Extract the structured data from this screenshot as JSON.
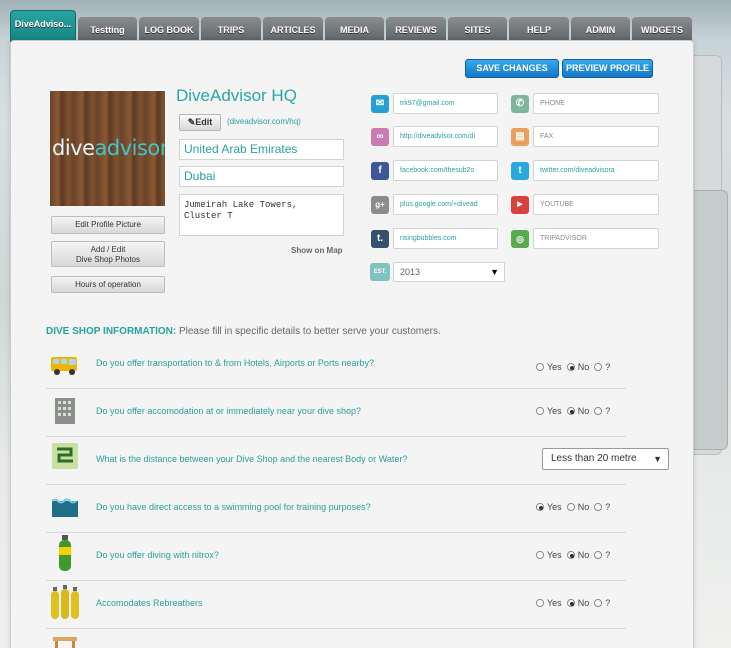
{
  "tabs": [
    {
      "label": "DiveAdvisor HQ",
      "active": true
    },
    {
      "label": "Testting"
    },
    {
      "label": "LOG BOOK"
    },
    {
      "label": "TRIPS"
    },
    {
      "label": "ARTICLES"
    },
    {
      "label": "MEDIA"
    },
    {
      "label": "REVIEWS"
    },
    {
      "label": "SITES"
    },
    {
      "label": "HELP"
    },
    {
      "label": "ADMIN"
    },
    {
      "label": "WIDGETS"
    }
  ],
  "tab_active_display": "DiveAdviso...",
  "actions": {
    "save": "SAVE CHANGES",
    "preview": "PREVIEW PROFILE"
  },
  "profile": {
    "name": "DiveAdvisor HQ",
    "edit_label": "Edit",
    "url": "(diveadvisor.com/hq)",
    "country": "United Arab Emirates",
    "city": "Dubai",
    "address": "Jumeirah Lake Towers,\nCluster T",
    "show_map": "Show on Map",
    "logo_text_a": "dive",
    "logo_text_b": "advisor"
  },
  "side_buttons": {
    "edit_picture": "Edit Profile Picture",
    "add_photos_1": "Add / Edit",
    "add_photos_2": "Dive Shop Photos",
    "hours": "Hours of operation"
  },
  "contacts": {
    "email": "trk97@gmail.com",
    "phone": "PHONE",
    "website": "http://diveadvisor.com/di",
    "fax": "FAX",
    "facebook": "facebook.com/thesub2o",
    "twitter": "twitter.com/diveadvisora",
    "googleplus": "plus.google.com/+divead",
    "youtube": "YOUTUBE",
    "tumblr": "risingbubbles.com",
    "tripadvisor": "TRIPADVISOR",
    "established": "2013",
    "est_label": "EST."
  },
  "icon_colors": {
    "email": "#2a9fd6",
    "phone": "#7fb59a",
    "website": "#c97bb2",
    "fax": "#e8a05a",
    "facebook": "#3b5998",
    "twitter": "#2aa9e0",
    "googleplus": "#8c8c8c",
    "youtube": "#d9413a",
    "tumblr": "#35506e",
    "tripadvisor": "#5aaa50",
    "est": "#7fc4c0"
  },
  "section": {
    "title": "DIVE SHOP INFORMATION:",
    "subtitle": " Please fill in specific details to better serve your customers."
  },
  "questions": [
    {
      "text": "Do you offer transportation to & from Hotels, Airports or Ports nearby?",
      "answer": "No",
      "icon": "van-icon"
    },
    {
      "text": "Do you offer accomodation at or immediately near your dive shop?",
      "answer": "No",
      "icon": "building-icon"
    },
    {
      "text": "What is the distance between your Dive Shop and the nearest Body or Water?",
      "select": "Less than 20 metre",
      "icon": "map-icon"
    },
    {
      "text": "Do you have direct access to a swimming pool for training purposes?",
      "answer": "Yes",
      "icon": "pool-icon"
    },
    {
      "text": "Do you offer diving with nitrox?",
      "answer": "No",
      "icon": "nitrox-tank-icon"
    },
    {
      "text": "Accomodates Rebreathers",
      "answer": "No",
      "icon": "rebreather-tanks-icon"
    }
  ],
  "radio_labels": {
    "yes": "Yes",
    "no": "No",
    "unknown": "?"
  }
}
